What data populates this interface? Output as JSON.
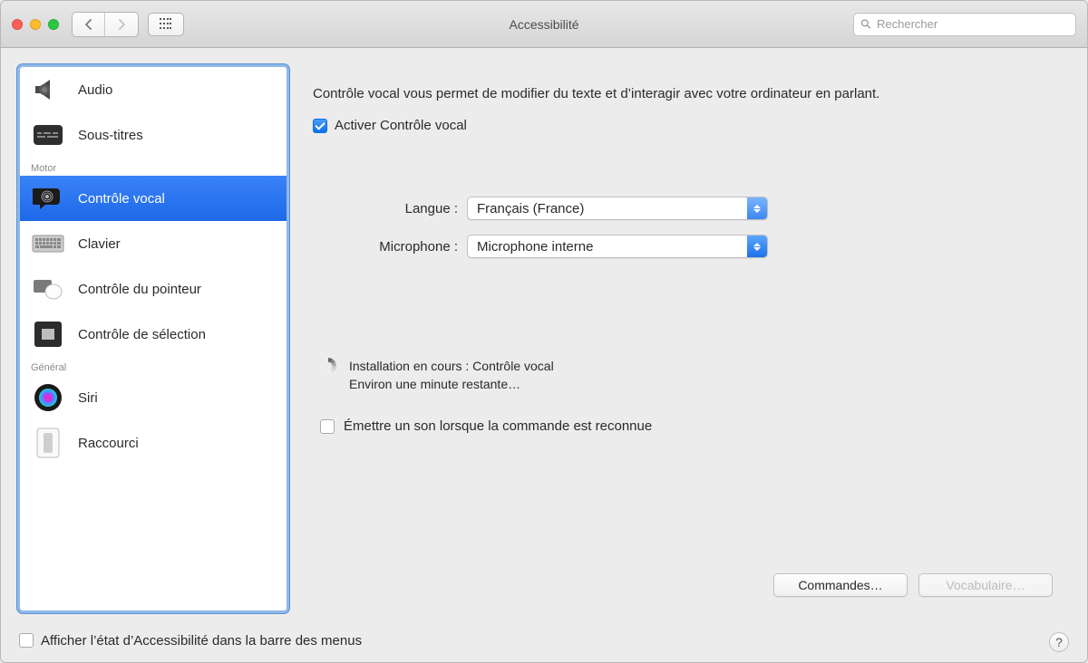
{
  "window": {
    "title": "Accessibilité"
  },
  "search": {
    "placeholder": "Rechercher"
  },
  "sidebar": {
    "headers": {
      "motor": "Motor",
      "general": "Général"
    },
    "items": {
      "audio": "Audio",
      "subtitles": "Sous-titres",
      "voice_control": "Contrôle vocal",
      "keyboard": "Clavier",
      "pointer": "Contrôle du pointeur",
      "switch": "Contrôle de sélection",
      "siri": "Siri",
      "shortcut": "Raccourci"
    }
  },
  "main": {
    "description": "Contrôle vocal vous permet de modifier du texte et d’interagir avec votre ordinateur en parlant.",
    "enable_label": "Activer Contrôle vocal",
    "enable_checked": true,
    "language_label": "Langue :",
    "language_value": "Français (France)",
    "microphone_label": "Microphone :",
    "microphone_value": "Microphone interne",
    "install_line1": "Installation en cours : Contrôle vocal",
    "install_line2": "Environ une minute restante…",
    "sound_label": "Émettre un son lorsque la commande est reconnue",
    "sound_checked": false,
    "commands_btn": "Commandes…",
    "vocab_btn": "Vocabulaire…"
  },
  "bottom": {
    "show_status": "Afficher l’état d’Accessibilité dans la barre des menus",
    "help_label": "?"
  }
}
